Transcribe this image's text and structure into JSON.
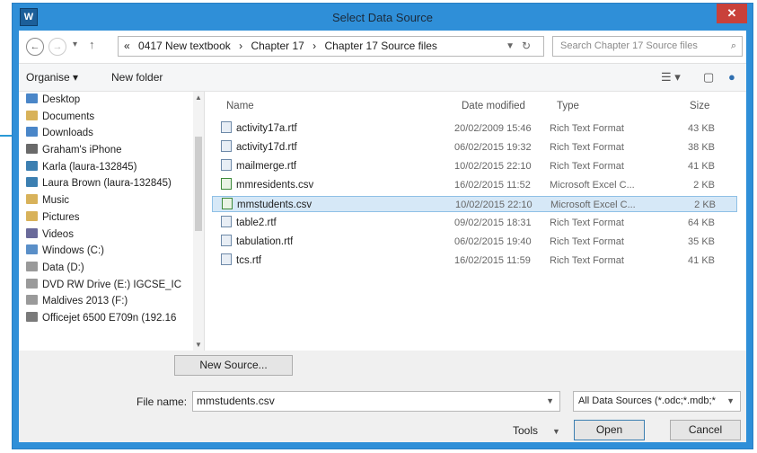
{
  "window": {
    "title": "Select Data Source",
    "close_glyph": "✕"
  },
  "nav": {
    "back": "←",
    "forward": "→",
    "recent": "▾",
    "up": "↑",
    "path_prefix": "«",
    "breadcrumb": [
      "0417 New textbook",
      "›",
      "Chapter 17",
      "›",
      "Chapter 17 Source files"
    ],
    "search_placeholder": "Search Chapter 17 Source files"
  },
  "toolbar": {
    "organise": "Organise ▾",
    "new_folder": "New folder"
  },
  "sidebar": {
    "items": [
      {
        "label": "Desktop",
        "color": "#4a86c8"
      },
      {
        "label": "Documents",
        "color": "#d8b25a"
      },
      {
        "label": "Downloads",
        "color": "#4a86c8"
      },
      {
        "label": "Graham's iPhone",
        "color": "#6a6a6a"
      },
      {
        "label": "Karla (laura-132845)",
        "color": "#3c7fb1"
      },
      {
        "label": "Laura Brown (laura-132845)",
        "color": "#3c7fb1"
      },
      {
        "label": "Music",
        "color": "#d8b25a"
      },
      {
        "label": "Pictures",
        "color": "#d8b25a"
      },
      {
        "label": "Videos",
        "color": "#6a6a9a"
      },
      {
        "label": "Windows (C:)",
        "color": "#5a8fc8"
      },
      {
        "label": "Data (D:)",
        "color": "#9a9a9a"
      },
      {
        "label": "DVD RW Drive (E:) IGCSE_IC",
        "color": "#9a9a9a"
      },
      {
        "label": "Maldives 2013 (F:)",
        "color": "#9a9a9a"
      },
      {
        "label": "Officejet 6500 E709n (192.16",
        "color": "#7a7a7a"
      }
    ]
  },
  "filelist": {
    "headers": {
      "name": "Name",
      "date": "Date modified",
      "type": "Type",
      "size": "Size"
    },
    "rows": [
      {
        "name": "activity17a.rtf",
        "date": "20/02/2009 15:46",
        "type": "Rich Text Format",
        "size": "43 KB",
        "kind": "rtf",
        "selected": false
      },
      {
        "name": "activity17d.rtf",
        "date": "06/02/2015 19:32",
        "type": "Rich Text Format",
        "size": "38 KB",
        "kind": "rtf",
        "selected": false
      },
      {
        "name": "mailmerge.rtf",
        "date": "10/02/2015 22:10",
        "type": "Rich Text Format",
        "size": "41 KB",
        "kind": "rtf",
        "selected": false
      },
      {
        "name": "mmresidents.csv",
        "date": "16/02/2015 11:52",
        "type": "Microsoft Excel C...",
        "size": "2 KB",
        "kind": "csv",
        "selected": false
      },
      {
        "name": "mmstudents.csv",
        "date": "10/02/2015 22:10",
        "type": "Microsoft Excel C...",
        "size": "2 KB",
        "kind": "csv",
        "selected": true
      },
      {
        "name": "table2.rtf",
        "date": "09/02/2015 18:31",
        "type": "Rich Text Format",
        "size": "64 KB",
        "kind": "rtf",
        "selected": false
      },
      {
        "name": "tabulation.rtf",
        "date": "06/02/2015 19:40",
        "type": "Rich Text Format",
        "size": "35 KB",
        "kind": "rtf",
        "selected": false
      },
      {
        "name": "tcs.rtf",
        "date": "16/02/2015 11:59",
        "type": "Rich Text Format",
        "size": "41 KB",
        "kind": "rtf",
        "selected": false
      }
    ]
  },
  "bottom": {
    "new_source": "New Source...",
    "file_name_label": "File name:",
    "file_name_value": "mmstudents.csv",
    "filter_value": "All Data Sources (*.odc;*.mdb;*",
    "tools": "Tools",
    "open": "Open",
    "cancel": "Cancel"
  },
  "colors": {
    "accent": "#2f8fd8",
    "annotation": "#2a9ad6",
    "selection": "#d6e8f7"
  }
}
